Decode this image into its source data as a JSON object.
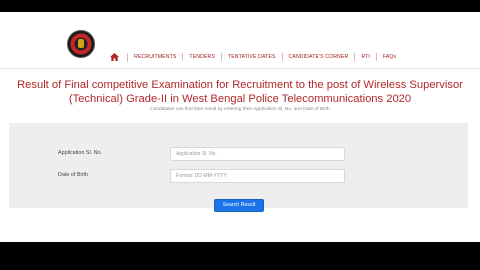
{
  "nav": {
    "home_icon": "home-icon",
    "items": [
      "RECRUITMENTS",
      "TENDERS",
      "TENTATIVE DATES",
      "CANDIDATE'S CORNER",
      "RTI",
      "FAQs"
    ]
  },
  "main": {
    "title": "Result of Final competitive Examination for Recruitment to the post of Wireless Supervisor (Technical) Grade-II in West Bengal Police Telecommunications 2020",
    "subtitle": "Candidates can find their result by entering their Application Sl. No. and Date of Birth"
  },
  "form": {
    "application_label": "Application Sl. No.",
    "application_placeholder": "Application Sl. No.",
    "dob_label": "Date of Birth",
    "dob_placeholder": "Format: DD-MM-YYYY",
    "search_label": "Search Result"
  },
  "colors": {
    "accent": "#b02828",
    "button": "#1a73e8",
    "panel": "#eeeeee"
  }
}
